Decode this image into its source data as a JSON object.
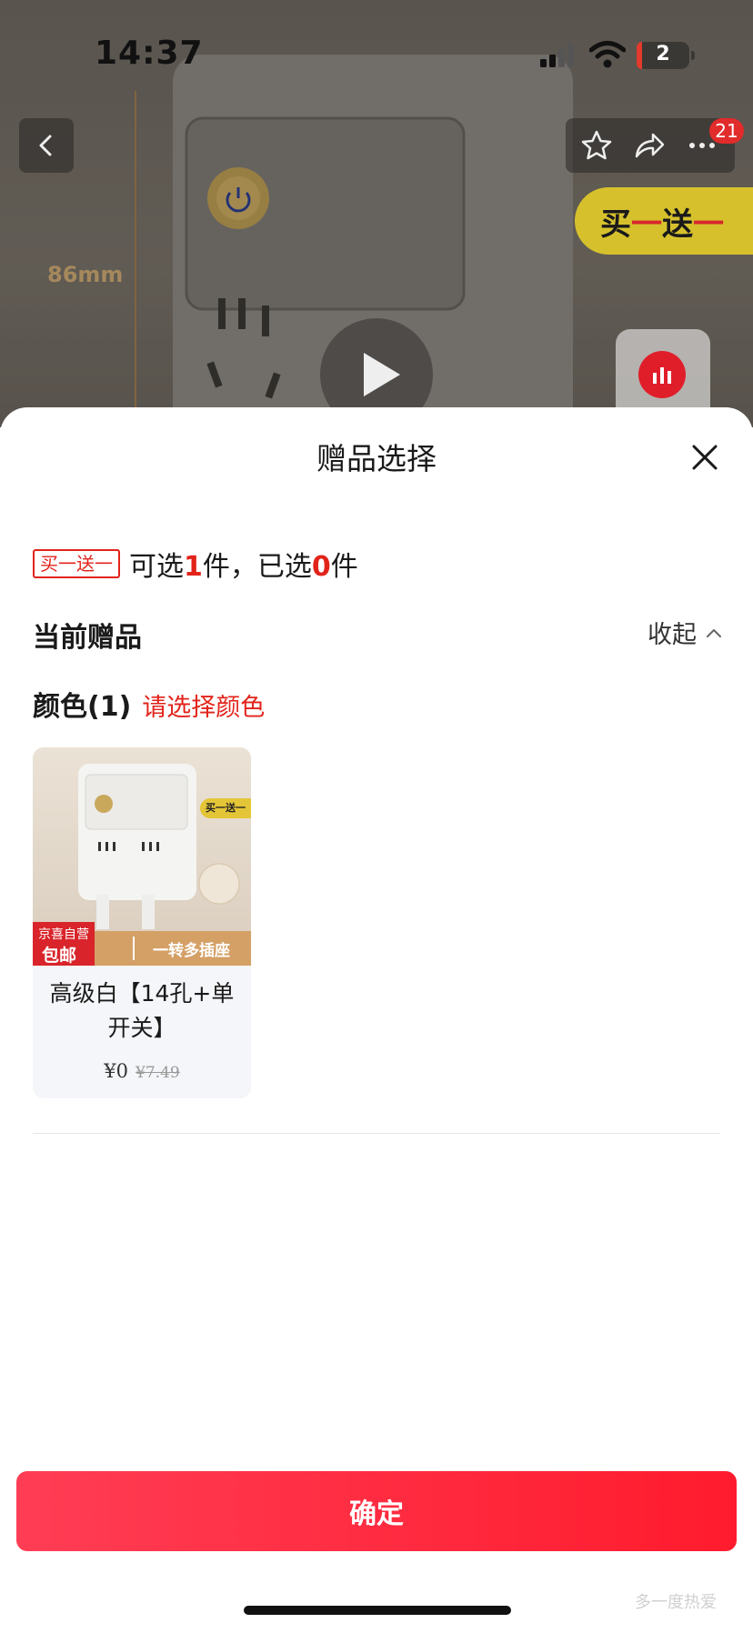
{
  "status_bar": {
    "time": "14:37",
    "battery": "2"
  },
  "nav": {
    "badge_count": "21"
  },
  "photo": {
    "promo_tag_main": "买",
    "promo_tag_dash": "一",
    "promo_tag_tail": "送",
    "size_label": "86mm"
  },
  "sheet": {
    "title": "赠品选择",
    "rule": {
      "tag": "买一送一",
      "prefix": "可选",
      "selectable": "1",
      "middle": "件，已选",
      "selected": "0",
      "suffix": "件"
    },
    "section_title": "当前赠品",
    "collapse_label": "收起",
    "color_label": "颜色(1)",
    "color_hint": "请选择颜色",
    "gift": {
      "name": "高级白【14孔+单开关】",
      "price": "¥0",
      "original_price": "¥7.49",
      "strip_text": "一转多插座",
      "jd_line1": "京喜自营",
      "jd_line2": "包邮",
      "mini_tag": "买一送一"
    },
    "confirm_label": "确定"
  },
  "watermark": "多一度热爱",
  "colors": {
    "accent": "#e2231a",
    "button_start": "#ff3d55",
    "button_end": "#ff1b2d"
  }
}
